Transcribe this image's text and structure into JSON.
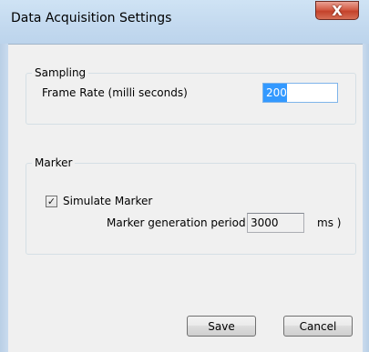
{
  "window": {
    "title": "Data Acquisition Settings",
    "close_glyph": "X"
  },
  "sampling": {
    "legend": "Sampling",
    "frame_rate_label": "Frame Rate (milli seconds)",
    "frame_rate_value": "200"
  },
  "marker": {
    "legend": "Marker",
    "simulate_label": "Simulate Marker",
    "simulate_checked": true,
    "period_prefix": "Marker generation period (",
    "period_value": "3000",
    "period_suffix": "ms )"
  },
  "buttons": {
    "save": "Save",
    "cancel": "Cancel"
  }
}
